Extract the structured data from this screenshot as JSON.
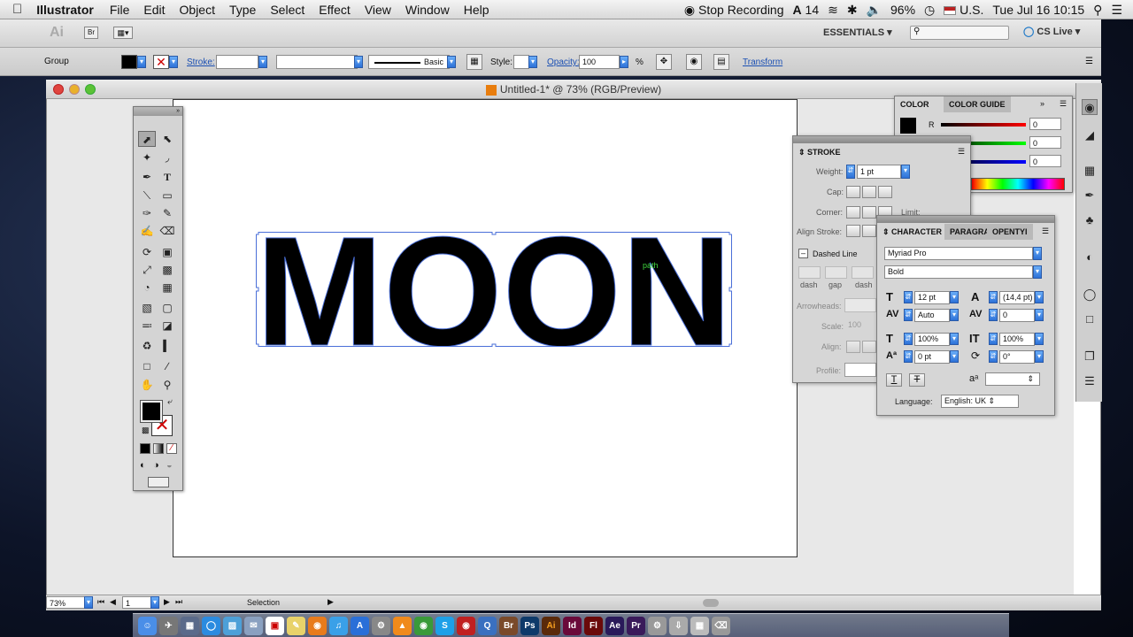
{
  "menubar": {
    "app": "Illustrator",
    "items": [
      "File",
      "Edit",
      "Object",
      "Type",
      "Select",
      "Effect",
      "View",
      "Window",
      "Help"
    ],
    "recording": "Stop Recording",
    "ai_badge": "14",
    "battery": "96%",
    "locale": "U.S.",
    "clock": "Tue Jul 16  10:15"
  },
  "appbar": {
    "logo": "Ai",
    "bridge": "Br",
    "workspace": "ESSENTIALS",
    "cs_live": "CS Live"
  },
  "control": {
    "selection": "Group",
    "stroke_label": "Stroke:",
    "brush": "Basic",
    "style_label": "Style:",
    "opacity_label": "Opacity:",
    "opacity": "100",
    "percent": "%",
    "transform": "Transform"
  },
  "document": {
    "title": "Untitled-1* @ 73% (RGB/Preview)",
    "artwork_text": "MOON",
    "cursor_hint": "path"
  },
  "status": {
    "zoom": "73%",
    "page": "1",
    "tool": "Selection"
  },
  "color_panel": {
    "tabs": [
      "COLOR",
      "COLOR GUIDE"
    ],
    "r": "0",
    "g": "0",
    "b": "0",
    "r_label": "R"
  },
  "stroke_panel": {
    "title": "STROKE",
    "weight_label": "Weight:",
    "weight": "1 pt",
    "cap_label": "Cap:",
    "corner_label": "Corner:",
    "limit_label": "Limit:",
    "align_label": "Align Stroke:",
    "dashed_label": "Dashed Line",
    "dash1": "dash",
    "gap1": "gap",
    "dash2": "dash",
    "arrowheads_label": "Arrowheads:",
    "scale_label": "Scale:",
    "scale": "100",
    "align2_label": "Align:",
    "profile_label": "Profile:"
  },
  "character_panel": {
    "tabs": [
      "CHARACTER",
      "PARAGRA",
      "OPENTYI"
    ],
    "font": "Myriad Pro",
    "style": "Bold",
    "size": "12 pt",
    "leading": "(14,4 pt)",
    "kerning": "Auto",
    "tracking": "0",
    "vscale": "100%",
    "hscale": "100%",
    "baseline": "0 pt",
    "rotation": "0°",
    "language_label": "Language:",
    "language": "English: UK"
  },
  "colors": {
    "accent": "#2d72d8",
    "selection": "#4a6fd8"
  }
}
